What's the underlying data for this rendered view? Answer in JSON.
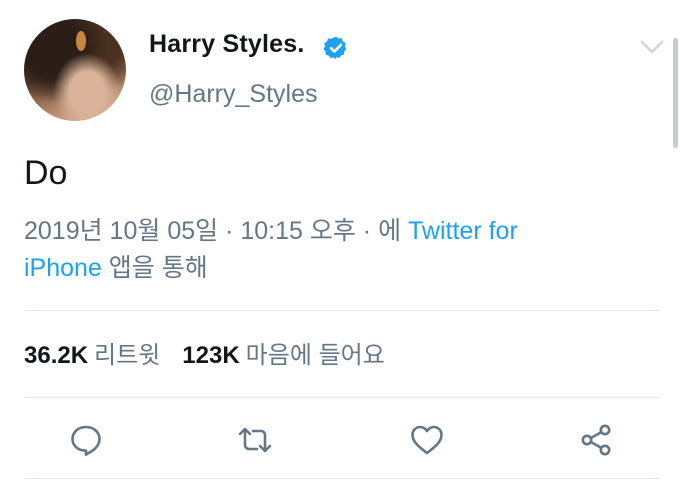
{
  "author": {
    "name": "Harry Styles.",
    "handle": "@Harry_Styles",
    "verified": true,
    "avatar": "profile-photo"
  },
  "tweet": {
    "text": "Do",
    "date": "2019년 10월 05일",
    "sep1": " · ",
    "time": "10:15 오후",
    "sep2": " · 에 ",
    "client_line1": "Twitter for",
    "client_line2": "iPhone",
    "via_suffix": " 앱을 통해"
  },
  "stats": {
    "retweets": "36.2K",
    "retweets_label": "리트윗",
    "likes": "123K",
    "likes_label": "마음에 들어요"
  },
  "actions": [
    {
      "name": "reply",
      "icon": "reply-icon"
    },
    {
      "name": "retweet",
      "icon": "retweet-icon"
    },
    {
      "name": "like",
      "icon": "heart-icon"
    },
    {
      "name": "share",
      "icon": "share-icon"
    }
  ],
  "colors": {
    "link": "#1da1f2",
    "secondary_text": "#657786",
    "primary_text": "#14171a",
    "icon": "#657786",
    "verified": "#1da1f2"
  }
}
